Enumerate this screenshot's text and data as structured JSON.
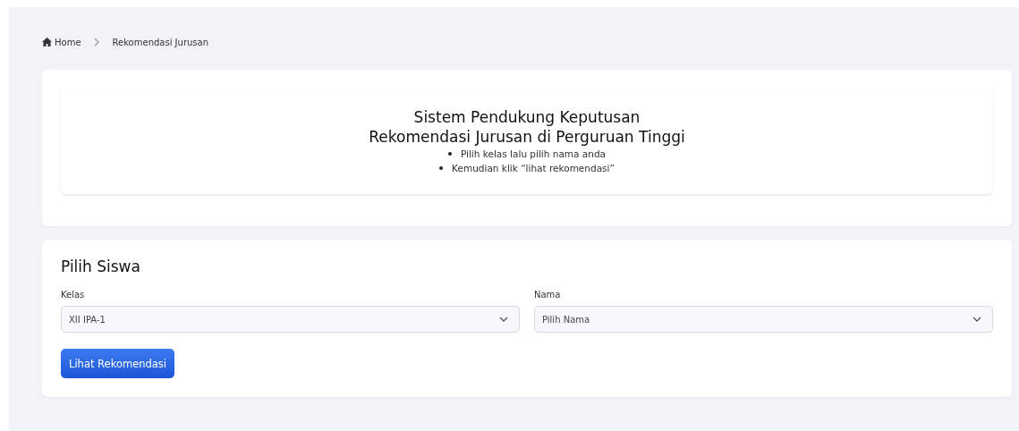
{
  "breadcrumb": [
    {
      "label": "Home",
      "kind": "home"
    },
    {
      "label": "Rekomendasi Jurusan",
      "kind": "current"
    }
  ],
  "intro": {
    "title_lines": [
      "Sistem Pendukung Keputusan",
      "Rekomendasi Jurusan di Perguruan Tinggi"
    ],
    "instructions": [
      "Pilih kelas lalu pilih nama anda",
      "Kemudian klik “lihat rekomendasi”"
    ]
  },
  "form": {
    "heading": "Pilih Siswa",
    "fields": [
      {
        "label": "Kelas",
        "value": "XII IPA-1"
      },
      {
        "label": "Nama",
        "placeholder": "Pilih Nama"
      }
    ],
    "button": "Lihat Rekomendasi"
  }
}
